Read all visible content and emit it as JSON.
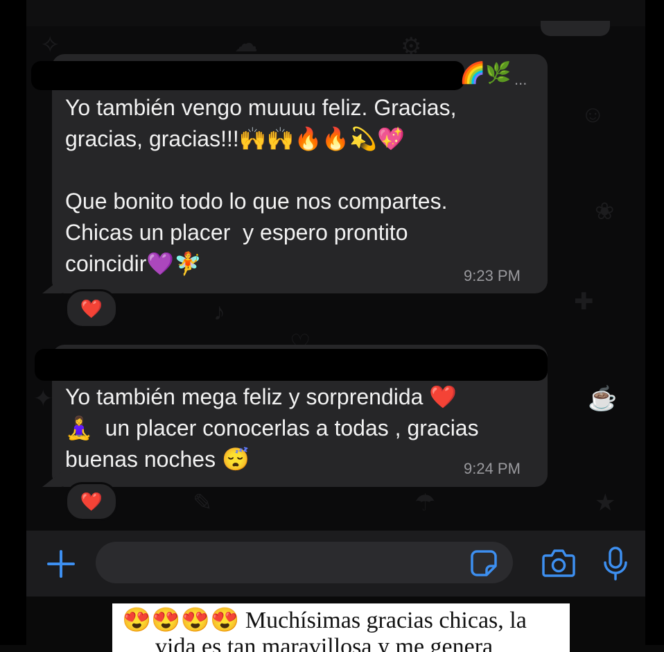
{
  "messages": [
    {
      "sender_emoji": "🌈🌿",
      "ellipsis": "...",
      "text": "Yo también vengo muuuu feliz. Gracias,\ngracias, gracias!!!🙌🙌🔥🔥💫💖\n\nQue bonito todo lo que nos compartes.\nChicas un placer  y espero prontito\ncoincidir💜🧚",
      "time": "9:23 PM",
      "reaction": "❤️"
    },
    {
      "text": "Yo también mega feliz y sorprendida ❤️\n🧘‍♀️  un placer conocerlas a todas , gracias\nbuenas noches 😴",
      "time": "9:24 PM",
      "reaction": "❤️"
    }
  ],
  "composer": {
    "icons": [
      "plus-icon",
      "sticker-icon",
      "camera-icon",
      "microphone-icon"
    ],
    "accent_color": "#3d8ff0"
  },
  "caption": {
    "line1": "😍😍😍😍 Muchísimas gracias chicas, la",
    "line2": "vida es tan maravillosa y me genera"
  }
}
